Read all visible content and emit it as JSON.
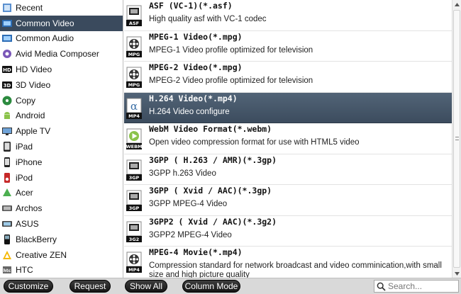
{
  "sidebar": {
    "items": [
      {
        "label": "Recent",
        "icon": "recent-icon"
      },
      {
        "label": "Common Video",
        "icon": "common-video-icon",
        "selected": true
      },
      {
        "label": "Common Audio",
        "icon": "common-audio-icon"
      },
      {
        "label": "Avid Media Composer",
        "icon": "avid-icon"
      },
      {
        "label": "HD Video",
        "icon": "hd-video-icon"
      },
      {
        "label": "3D Video",
        "icon": "3d-video-icon"
      },
      {
        "label": "Copy",
        "icon": "copy-icon"
      },
      {
        "label": "Android",
        "icon": "android-icon"
      },
      {
        "label": "Apple TV",
        "icon": "apple-tv-icon"
      },
      {
        "label": "iPad",
        "icon": "ipad-icon"
      },
      {
        "label": "iPhone",
        "icon": "iphone-icon"
      },
      {
        "label": "iPod",
        "icon": "ipod-icon"
      },
      {
        "label": "Acer",
        "icon": "acer-icon"
      },
      {
        "label": "Archos",
        "icon": "archos-icon"
      },
      {
        "label": "ASUS",
        "icon": "asus-icon"
      },
      {
        "label": "BlackBerry",
        "icon": "blackberry-icon"
      },
      {
        "label": "Creative ZEN",
        "icon": "creative-zen-icon"
      },
      {
        "label": "HTC",
        "icon": "htc-icon"
      }
    ]
  },
  "formats": {
    "items": [
      {
        "title": "ASF (VC-1)(*.asf)",
        "desc": "High quality asf with VC-1 codec",
        "badge": "ASF",
        "icon": "asf-file-icon"
      },
      {
        "title": "MPEG-1 Video(*.mpg)",
        "desc": "MPEG-1 Video profile optimized for television",
        "badge": "MPG",
        "icon": "mpeg1-reel-icon"
      },
      {
        "title": "MPEG-2 Video(*.mpg)",
        "desc": "MPEG-2 Video profile optimized for television",
        "badge": "MPG",
        "icon": "mpeg2-reel-icon"
      },
      {
        "title": "H.264 Video(*.mp4)",
        "desc": "H.264 Video configure",
        "badge": "MP4",
        "icon": "h264-file-icon",
        "selected": true
      },
      {
        "title": "WebM Video Format(*.webm)",
        "desc": "Open video compression format for use with HTML5 video",
        "badge": "WEBM",
        "icon": "webm-file-icon"
      },
      {
        "title": "3GPP ( H.263 / AMR)(*.3gp)",
        "desc": "3GPP h.263 Video",
        "badge": "3GP",
        "icon": "3gp-h263-file-icon"
      },
      {
        "title": "3GPP ( Xvid / AAC)(*.3gp)",
        "desc": "3GPP MPEG-4 Video",
        "badge": "3GP",
        "icon": "3gp-xvid-file-icon"
      },
      {
        "title": "3GPP2 ( Xvid / AAC)(*.3g2)",
        "desc": "3GPP2 MPEG-4 Video",
        "badge": "3G2",
        "icon": "3g2-file-icon"
      },
      {
        "title": "MPEG-4 Movie(*.mp4)",
        "desc": "Compression standard for network broadcast and video comminication,with small size and high picture quality",
        "badge": "MP4",
        "icon": "mpeg4-movie-icon"
      }
    ]
  },
  "toolbar": {
    "customize_label": "Customize",
    "request_label": "Request",
    "show_all_label": "Show All",
    "column_mode_label": "Column Mode",
    "search_placeholder": "Search..."
  },
  "colors": {
    "selected_background": "#3a4a5d",
    "button_background": "#1f1f1f",
    "toolbar_background": "#d9d9d9"
  }
}
